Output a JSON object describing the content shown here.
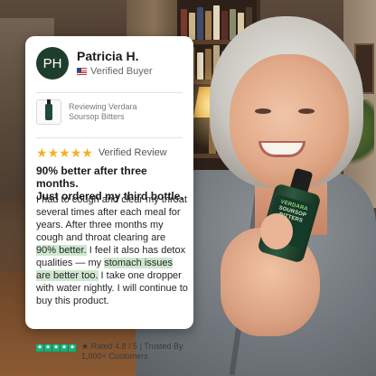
{
  "review": {
    "avatar_initials": "PH",
    "reviewer_name": "Patricia H.",
    "verified_buyer": "Verified Buyer",
    "product_line1": "Reviewing Verdara",
    "product_line2": "Soursop Bitters",
    "rating": 5,
    "stars": [
      "★",
      "★",
      "★",
      "★",
      "★"
    ],
    "verified_review": "Verified Review",
    "headline_line1": "90% better after three months.",
    "headline_line2": "Just ordered my third bottle.",
    "body": {
      "part1": "I had to cough and clear my throat several times after each meal for years. After three months my cough and throat clearing are ",
      "highlight1": "90% better.",
      "part2": " I feel it also has detox qualities — my ",
      "highlight2": "stomach issues are better too.",
      "part3": " I take one dropper with water nightly. I will continue to buy this product."
    },
    "footer_line1": "Rated 4.8 / 5 | Trusted By",
    "footer_line2": "1,000+ Customers",
    "trust_stars": [
      "★",
      "★",
      "★",
      "★",
      "★"
    ]
  },
  "bottle_label": {
    "line1": "VERDARA",
    "line2": "SOURSOP",
    "line3": "BITTERS"
  },
  "colors": {
    "avatar_bg": "#1f3d2d",
    "star": "#f3b125",
    "highlight": "#cfe7cf",
    "trust_green": "#00b67a"
  },
  "icons": [
    "us-flag-icon",
    "product-thumbnail-icon",
    "star-icon",
    "trustpilot-star-icon"
  ]
}
